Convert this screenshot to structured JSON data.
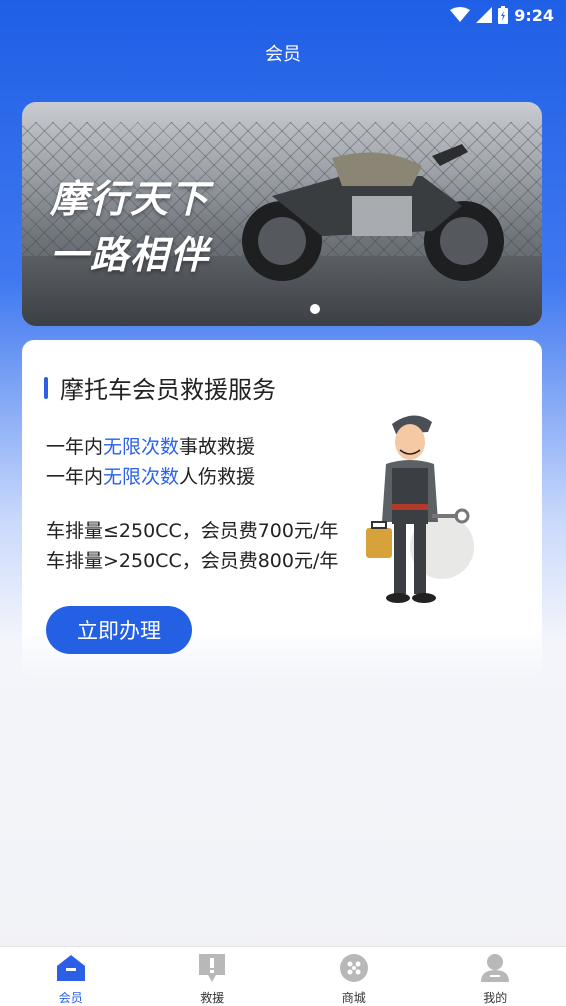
{
  "status_bar": {
    "time": "9:24"
  },
  "header": {
    "title": "会员"
  },
  "banner": {
    "slogan_line1": "摩行天下",
    "slogan_line2": "一路相伴"
  },
  "service_card": {
    "title": "摩托车会员救援服务",
    "line1": {
      "prefix": "一年内",
      "highlight": "无限次数",
      "suffix": "事故救援"
    },
    "line2": {
      "prefix": "一年内",
      "highlight": "无限次数",
      "suffix": "人伤救援"
    },
    "price_line1": "车排量≤250CC，会员费700元/年",
    "price_line2": "车排量>250CC，会员费800元/年",
    "apply_button": "立即办理"
  },
  "tab_bar": {
    "items": [
      {
        "label": "会员",
        "icon": "member-home-icon",
        "active": true
      },
      {
        "label": "救援",
        "icon": "rescue-alert-icon",
        "active": false
      },
      {
        "label": "商城",
        "icon": "mall-icon",
        "active": false
      },
      {
        "label": "我的",
        "icon": "profile-icon",
        "active": false
      }
    ]
  },
  "colors": {
    "primary": "#2460e3",
    "highlight": "#2a62e8",
    "tab_inactive": "#b8b8b8"
  }
}
